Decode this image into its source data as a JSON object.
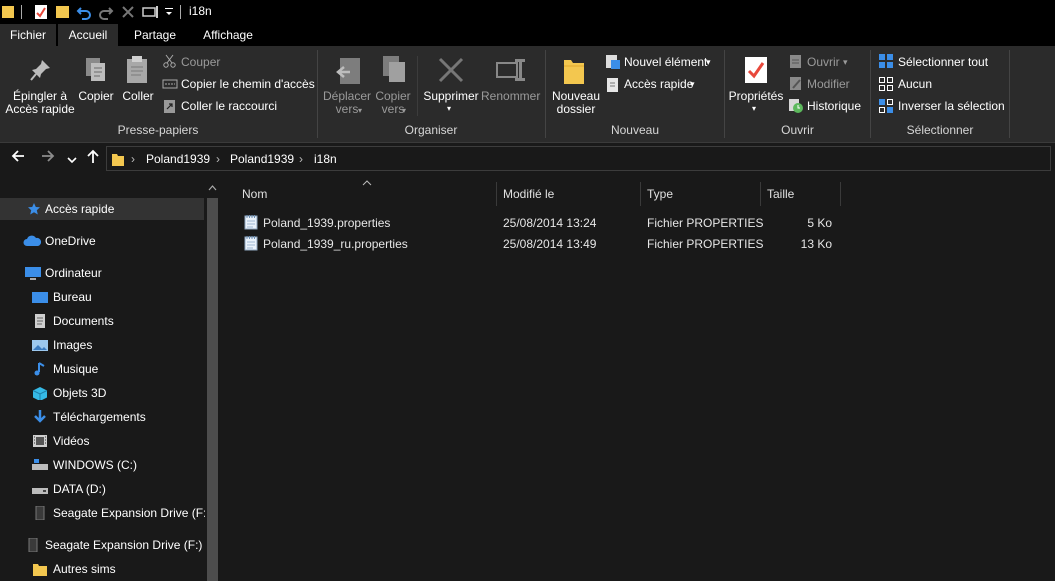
{
  "window": {
    "title": "i18n"
  },
  "tabs": [
    {
      "label": "Fichier"
    },
    {
      "label": "Accueil"
    },
    {
      "label": "Partage"
    },
    {
      "label": "Affichage"
    }
  ],
  "ribbon": {
    "clipboard": {
      "title": "Presse-papiers",
      "pin": "Épingler à\nAccès rapide",
      "copy": "Copier",
      "paste": "Coller",
      "cut": "Couper",
      "copy_path": "Copier le chemin d'accès",
      "paste_shortcut": "Coller le raccourci"
    },
    "organize": {
      "title": "Organiser",
      "move_to": "Déplacer\nvers",
      "copy_to": "Copier\nvers",
      "delete": "Supprimer",
      "rename": "Renommer"
    },
    "new": {
      "title": "Nouveau",
      "new_folder": "Nouveau\ndossier",
      "new_item": "Nouvel élément",
      "easy_access": "Accès rapide"
    },
    "open": {
      "title": "Ouvrir",
      "properties": "Propriétés",
      "open": "Ouvrir",
      "edit": "Modifier",
      "history": "Historique"
    },
    "select": {
      "title": "Sélectionner",
      "select_all": "Sélectionner tout",
      "select_none": "Aucun",
      "invert": "Inverser la sélection"
    }
  },
  "address": {
    "crumbs": [
      "Poland1939",
      "Poland1939",
      "i18n"
    ]
  },
  "nav": [
    {
      "label": "Accès rapide",
      "icon": "star-icon"
    },
    {
      "label": "OneDrive",
      "icon": "cloud-icon"
    },
    {
      "label": "Ordinateur",
      "icon": "computer-icon"
    },
    {
      "label": "Bureau",
      "icon": "desktop-icon"
    },
    {
      "label": "Documents",
      "icon": "documents-icon"
    },
    {
      "label": "Images",
      "icon": "pictures-icon"
    },
    {
      "label": "Musique",
      "icon": "music-icon"
    },
    {
      "label": "Objets 3D",
      "icon": "objects-3d-icon"
    },
    {
      "label": "Téléchargements",
      "icon": "download-icon"
    },
    {
      "label": "Vidéos",
      "icon": "video-icon"
    },
    {
      "label": "WINDOWS (C:)",
      "icon": "system-drive-icon"
    },
    {
      "label": "DATA (D:)",
      "icon": "drive-icon"
    },
    {
      "label": "Seagate Expansion Drive (F:)",
      "icon": "external-drive-icon"
    },
    {
      "label": "Seagate Expansion Drive (F:)",
      "icon": "external-drive-icon"
    },
    {
      "label": "Autres sims",
      "icon": "folder-icon"
    }
  ],
  "columns": {
    "name": "Nom",
    "modified": "Modifié le",
    "type": "Type",
    "size": "Taille"
  },
  "files": [
    {
      "name": "Poland_1939.properties",
      "modified": "25/08/2014 13:24",
      "type": "Fichier PROPERTIES",
      "size": "5 Ko"
    },
    {
      "name": "Poland_1939_ru.properties",
      "modified": "25/08/2014 13:49",
      "type": "Fichier PROPERTIES",
      "size": "13 Ko"
    }
  ]
}
